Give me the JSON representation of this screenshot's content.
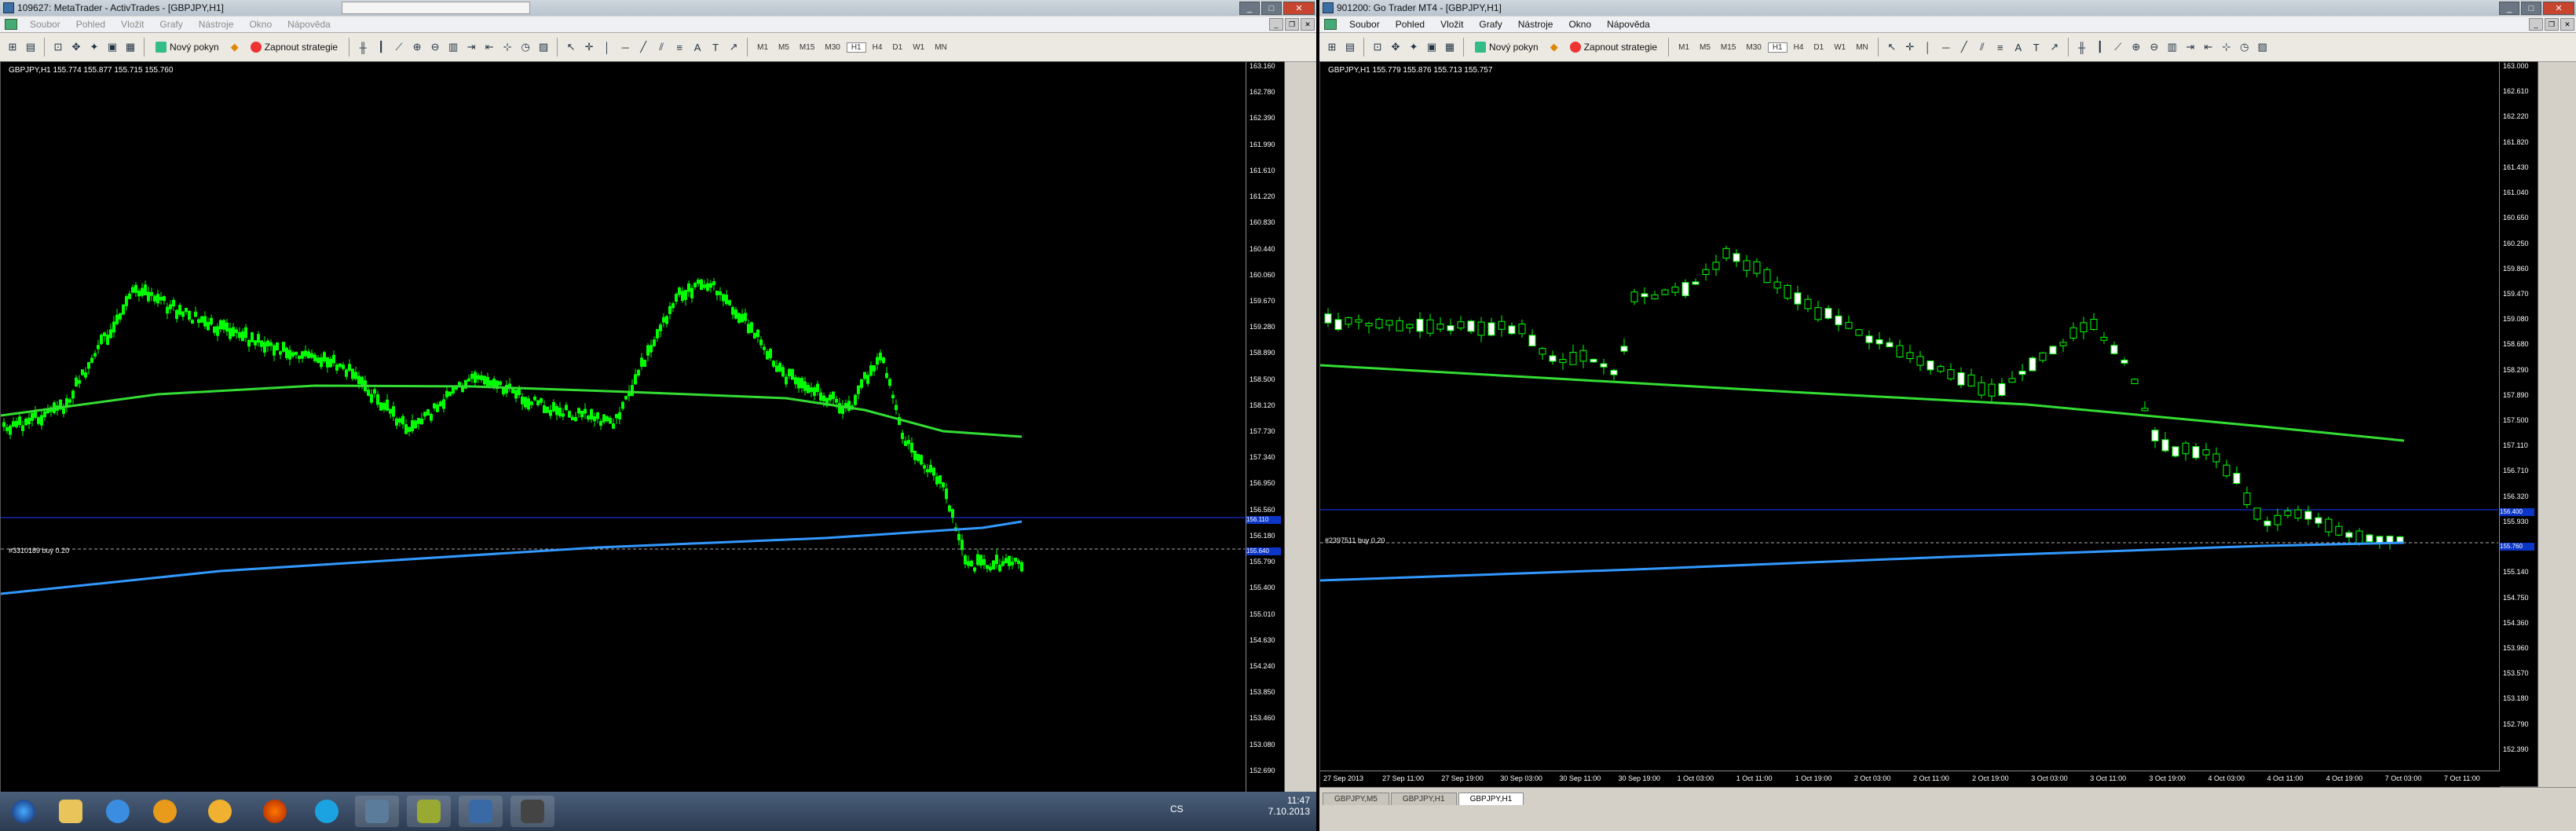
{
  "windows": [
    {
      "title": "109627: MetaTrader - ActivTrades - [GBPJPY,H1]",
      "menu": [
        "Soubor",
        "Pohled",
        "Vložit",
        "Grafy",
        "Nástroje",
        "Okno",
        "Nápověda"
      ],
      "toolbar": {
        "new_order": "Nový pokyn",
        "start_strategy": "Zapnout strategie",
        "timeframes": [
          "M1",
          "M5",
          "M15",
          "M30",
          "H1",
          "H4",
          "D1",
          "W1",
          "MN"
        ],
        "active_timeframe": "H1"
      },
      "chart": {
        "symbol_line": "GBPJPY,H1  155.774 155.877 155.715 155.760",
        "order_label": "#3310189 buy 0.20",
        "price_ticks": [
          "163.160",
          "162.780",
          "162.390",
          "161.990",
          "161.610",
          "161.220",
          "160.830",
          "160.440",
          "160.060",
          "159.670",
          "159.280",
          "158.890",
          "158.500",
          "158.120",
          "157.730",
          "157.340",
          "156.950",
          "156.560",
          "156.180",
          "155.790",
          "155.400",
          "155.010",
          "154.630",
          "154.240",
          "153.850",
          "153.460",
          "153.080",
          "152.690"
        ],
        "price_tags": [
          "156.110",
          "155.640"
        ]
      }
    },
    {
      "title": "901200: Go Trader MT4 - [GBPJPY,H1]",
      "menu": [
        "Soubor",
        "Pohled",
        "Vložit",
        "Grafy",
        "Nástroje",
        "Okno",
        "Nápověda"
      ],
      "toolbar": {
        "new_order": "Nový pokyn",
        "start_strategy": "Zapnout strategie",
        "timeframes": [
          "M1",
          "M5",
          "M15",
          "M30",
          "H1",
          "H4",
          "D1",
          "W1",
          "MN"
        ],
        "active_timeframe": "H1"
      },
      "chart": {
        "symbol_line": "GBPJPY,H1  155.779 155.876 155.713 155.757",
        "order_label": "#2397511 buy 0.20",
        "price_ticks": [
          "163.000",
          "162.610",
          "162.220",
          "161.820",
          "161.430",
          "161.040",
          "160.650",
          "160.250",
          "159.860",
          "159.470",
          "159.080",
          "158.680",
          "158.290",
          "157.890",
          "157.500",
          "157.110",
          "156.710",
          "156.320",
          "155.930",
          "155.530",
          "155.140",
          "154.750",
          "154.360",
          "153.960",
          "153.570",
          "153.180",
          "152.790",
          "152.390"
        ],
        "price_tags": [
          "156.400",
          "155.760"
        ],
        "date_ticks": [
          "27 Sep 2013",
          "27 Sep 11:00",
          "27 Sep 19:00",
          "30 Sep 03:00",
          "30 Sep 11:00",
          "30 Sep 19:00",
          "1 Oct 03:00",
          "1 Oct 11:00",
          "1 Oct 19:00",
          "2 Oct 03:00",
          "2 Oct 11:00",
          "2 Oct 19:00",
          "3 Oct 03:00",
          "3 Oct 11:00",
          "3 Oct 19:00",
          "4 Oct 03:00",
          "4 Oct 11:00",
          "4 Oct 19:00",
          "7 Oct 03:00",
          "7 Oct 11:00"
        ],
        "tabs": [
          "GBPJPY,M5",
          "GBPJPY,H1",
          "GBPJPY,H1"
        ],
        "active_tab": 2
      }
    }
  ],
  "taskbar": {
    "language": "CS",
    "time": "11:47",
    "date": "7.10.2013"
  },
  "colors": {
    "chart_bg": "#000000",
    "candles": "#00ff00",
    "ma_slow": "#33dd33",
    "ma_blue": "#3399ff",
    "grid_blue": "#1a3cff",
    "price_tag": "#0b36c8"
  }
}
